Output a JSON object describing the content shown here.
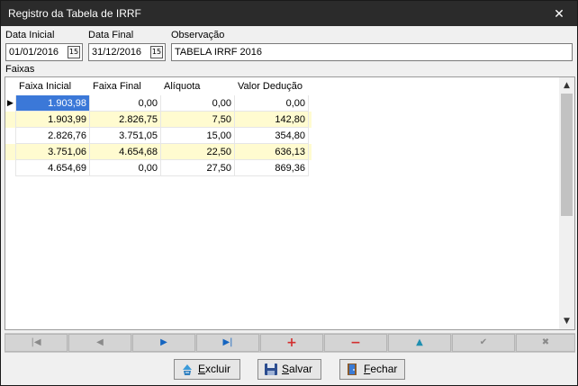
{
  "window": {
    "title": "Registro da Tabela de IRRF",
    "close_icon": "✕"
  },
  "form": {
    "data_inicial": {
      "label": "Data Inicial",
      "value": "01/01/2016"
    },
    "data_final": {
      "label": "Data Final",
      "value": "31/12/2016"
    },
    "observacao": {
      "label": "Observação",
      "value": "TABELA IRRF 2016"
    },
    "calendar_glyph": "15"
  },
  "faixas": {
    "label": "Faixas",
    "columns": [
      "Faixa Inicial",
      "Faixa Final",
      "Alíquota",
      "Valor Dedução"
    ],
    "rows": [
      [
        "1.903,98",
        "0,00",
        "0,00",
        "0,00"
      ],
      [
        "1.903,99",
        "2.826,75",
        "7,50",
        "142,80"
      ],
      [
        "2.826,76",
        "3.751,05",
        "15,00",
        "354,80"
      ],
      [
        "3.751,06",
        "4.654,68",
        "22,50",
        "636,13"
      ],
      [
        "4.654,69",
        "0,00",
        "27,50",
        "869,36"
      ]
    ],
    "selected_row": 0,
    "row_indicator": "▶"
  },
  "navigator": {
    "buttons": [
      "first",
      "prior",
      "next",
      "last",
      "insert",
      "delete",
      "edit",
      "post",
      "cancel"
    ]
  },
  "actions": {
    "excluir": {
      "prefix": "",
      "mnemonic": "E",
      "rest": "xcluir"
    },
    "salvar": {
      "prefix": "",
      "mnemonic": "S",
      "rest": "alvar"
    },
    "fechar": {
      "prefix": "",
      "mnemonic": "F",
      "rest": "echar"
    }
  },
  "colors": {
    "selection": "#3b78d8",
    "alt_row": "#fffbd0",
    "nav_blue": "#1565c0",
    "nav_red": "#d32f2f",
    "nav_teal": "#1f8fb0"
  }
}
